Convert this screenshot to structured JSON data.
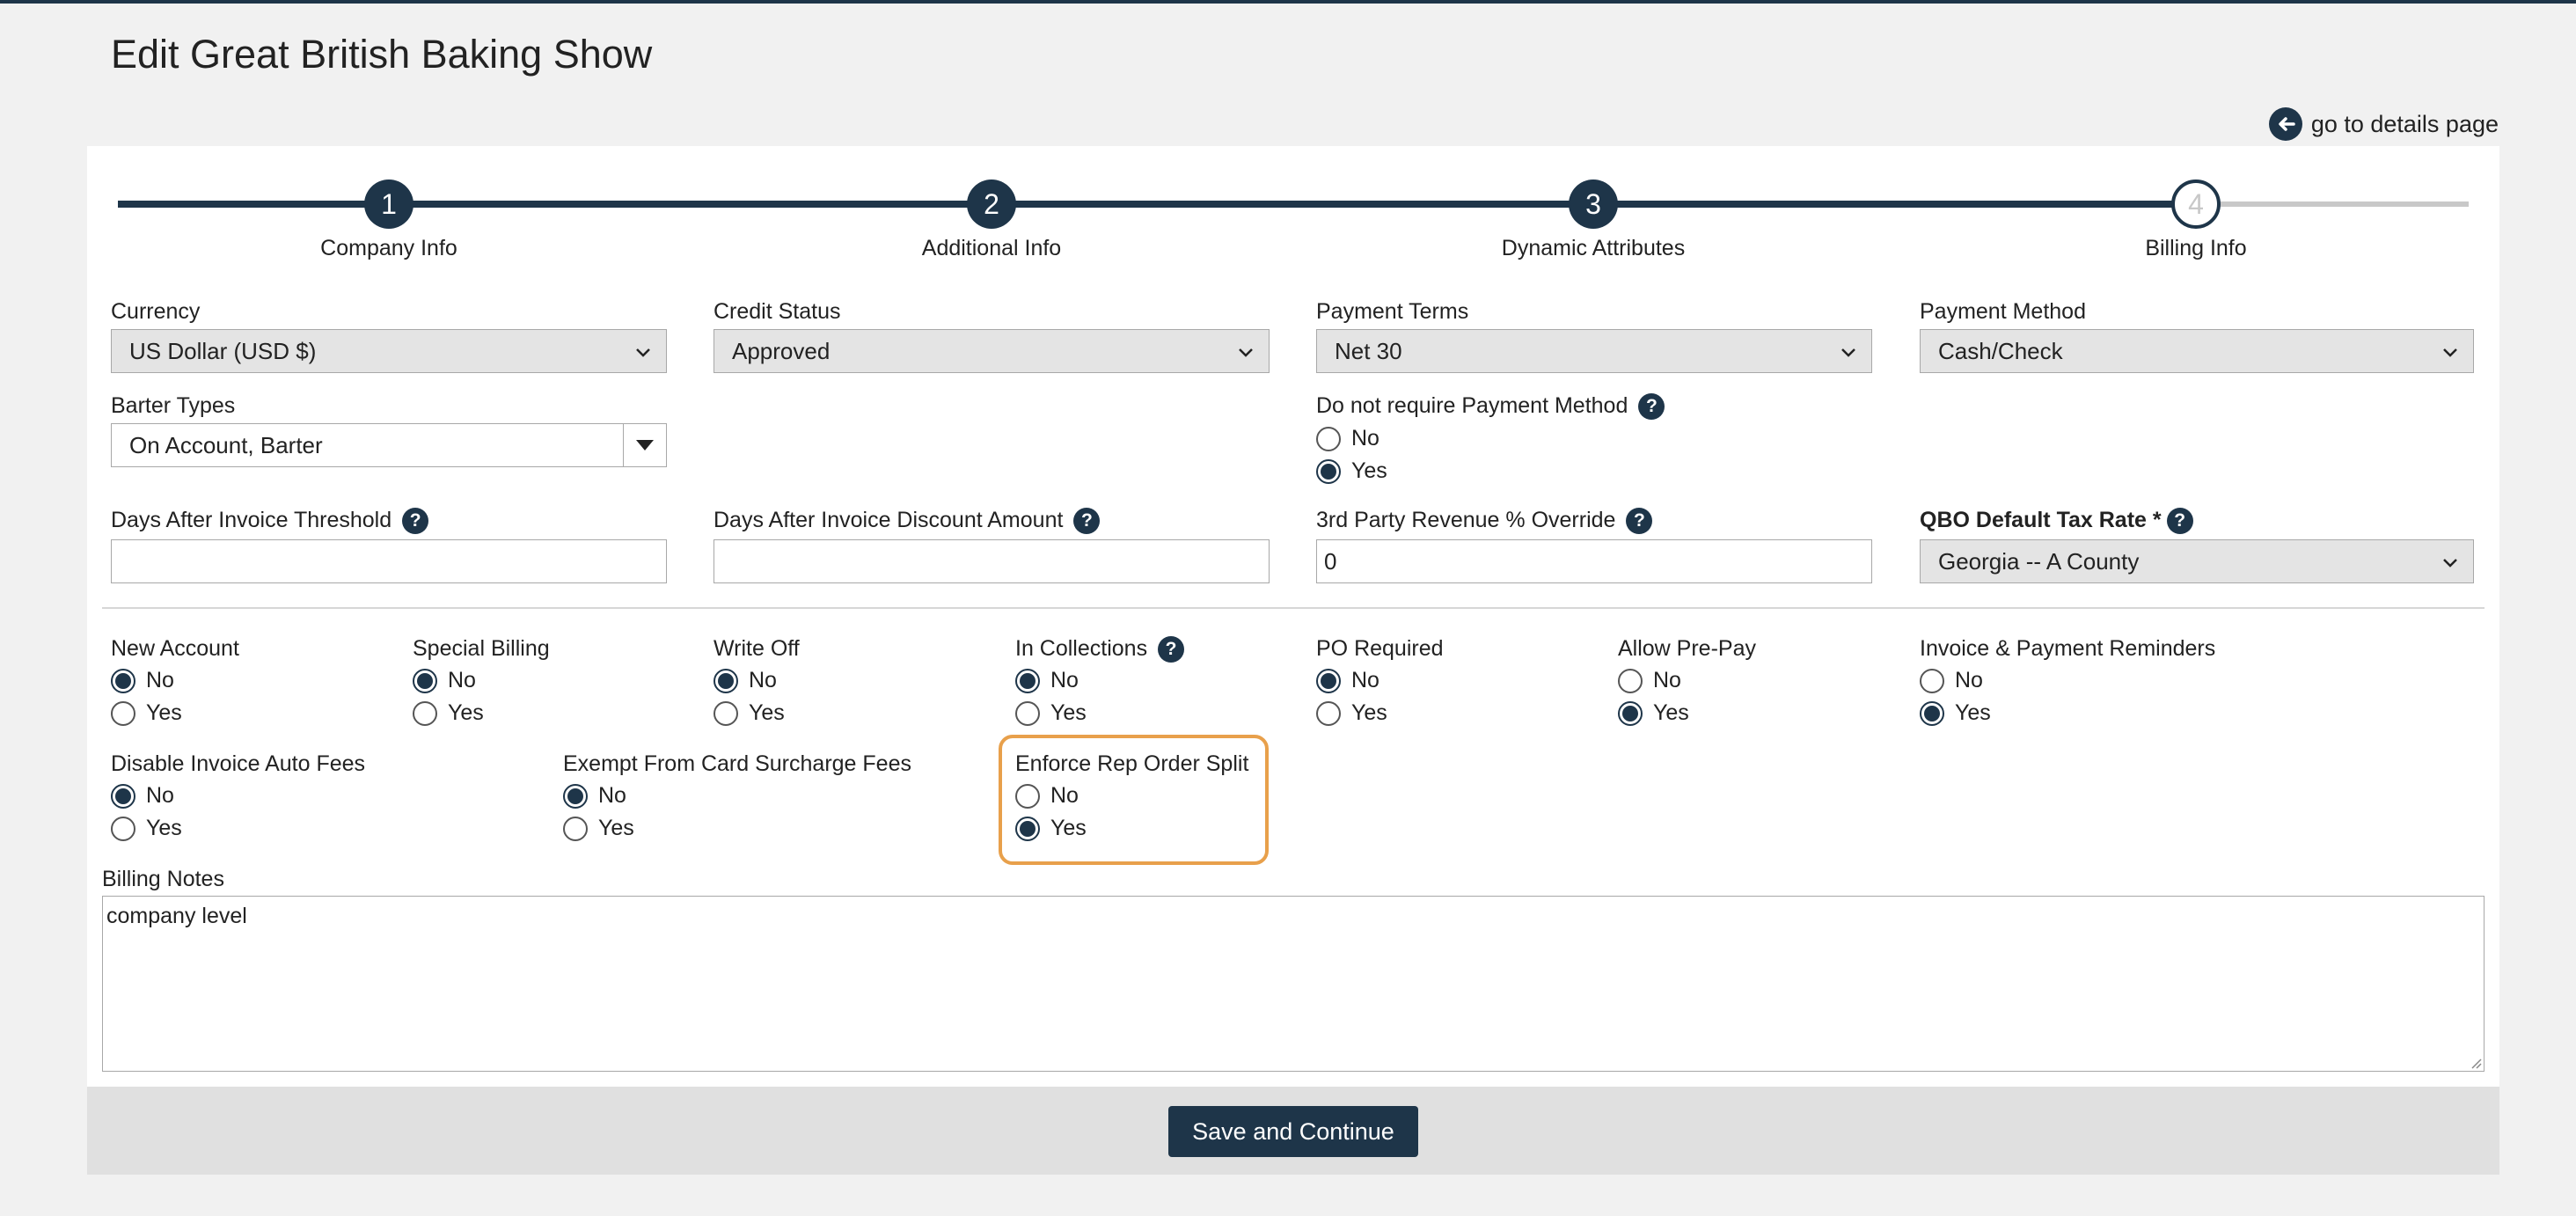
{
  "page": {
    "title": "Edit Great British Baking Show"
  },
  "links": {
    "go_to_details": "go to details page"
  },
  "colors": {
    "primary": "#1e3549",
    "highlight": "#e8a04b",
    "pending": "#c8c8c8"
  },
  "stepper": {
    "current_step": 4,
    "steps": [
      {
        "number": "1",
        "label": "Company Info",
        "state": "done"
      },
      {
        "number": "2",
        "label": "Additional Info",
        "state": "done"
      },
      {
        "number": "3",
        "label": "Dynamic Attributes",
        "state": "done"
      },
      {
        "number": "4",
        "label": "Billing Info",
        "state": "current"
      }
    ]
  },
  "fields": {
    "currency": {
      "label": "Currency",
      "value": "US Dollar (USD $)"
    },
    "credit_status": {
      "label": "Credit Status",
      "value": "Approved"
    },
    "payment_terms": {
      "label": "Payment Terms",
      "value": "Net 30"
    },
    "payment_method": {
      "label": "Payment Method",
      "value": "Cash/Check"
    },
    "barter_types": {
      "label": "Barter Types",
      "value": "On Account, Barter"
    },
    "no_payment_method": {
      "label": "Do not require Payment Method",
      "no": "No",
      "yes": "Yes",
      "selected": "Yes"
    },
    "days_threshold": {
      "label": "Days After Invoice Threshold",
      "value": ""
    },
    "days_discount": {
      "label": "Days After Invoice Discount Amount",
      "value": ""
    },
    "third_party_override": {
      "label": "3rd Party Revenue % Override",
      "value": "0"
    },
    "qbo_tax_rate": {
      "label": "QBO Default Tax Rate *",
      "value": "Georgia -- A County"
    }
  },
  "radio_groups": [
    {
      "label": "New Account",
      "selected": "No"
    },
    {
      "label": "Special Billing",
      "selected": "No"
    },
    {
      "label": "Write Off",
      "selected": "No"
    },
    {
      "label": "In Collections",
      "selected": "No"
    },
    {
      "label": "PO Required",
      "selected": "No"
    },
    {
      "label": "Allow Pre-Pay",
      "selected": "Yes"
    },
    {
      "label": "Invoice & Payment Reminders",
      "selected": "Yes"
    },
    {
      "label": "Disable Invoice Auto Fees",
      "selected": "No"
    },
    {
      "label": "Exempt From Card Surcharge Fees",
      "selected": "No"
    },
    {
      "label": "Enforce Rep Order Split",
      "selected": "Yes"
    }
  ],
  "options": {
    "no": "No",
    "yes": "Yes"
  },
  "billing_notes": {
    "label": "Billing Notes",
    "value": "company level"
  },
  "actions": {
    "save_continue": "Save and Continue"
  },
  "icons": {
    "back": "arrow-left-circle-icon",
    "help": "question-circle-icon",
    "dropdown": "chevron-down-icon"
  }
}
